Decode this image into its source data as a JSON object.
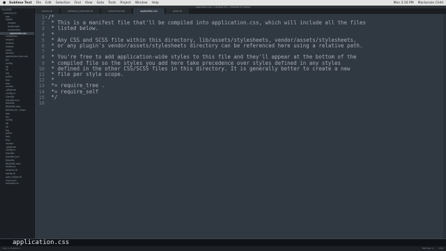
{
  "menubar": {
    "items": [
      "Sublime Text",
      "File",
      "Edit",
      "Selection",
      "Find",
      "View",
      "Goto",
      "Tools",
      "Project",
      "Window",
      "Help"
    ],
    "right_items": [
      "Mon 3:16 PM",
      "Mackenzie Child"
    ]
  },
  "window": {
    "title": "application.css — cardinal_fm — [Trashed for Share]"
  },
  "sidebar": {
    "items": [
      "FOLDERS",
      "cardinal_fm",
      "app",
      "assets",
      "images",
      "javascripts",
      "stylesheets",
      "application.css",
      "controllers",
      "helpers",
      "mailers",
      "models",
      "views",
      "layouts",
      "application.html.erb",
      "bin",
      "config",
      "db",
      "lib",
      "log",
      "public",
      "test",
      "tmp",
      "vendor",
      ".gitignore",
      "config.ru",
      "Gemfile",
      "Gemfile.lock",
      "Rakefile",
      "README.rdoc",
      "Refresh fm - finals",
      "app",
      "bin",
      "config",
      "db",
      "lib",
      "log",
      "public",
      "test",
      "tmp",
      "vendor",
      ".gitignore",
      "config.ru",
      "Gemfile",
      "Gemfile.lock",
      "Rakefile",
      "README.rdoc",
      "routes.rb",
      "schema.rb",
      "seeds.rb",
      "spec_helper.rb",
      "users.yml",
      "welcome.rb"
    ],
    "selected_index": 7
  },
  "tabs": [
    {
      "label": "routes.rb",
      "active": false
    },
    {
      "label": "welcome_controller.rb",
      "active": false
    },
    {
      "label": "index.html.erb",
      "active": false
    },
    {
      "label": "application.css",
      "active": true
    },
    {
      "label": "route.rb",
      "active": false
    }
  ],
  "editor": {
    "line_numbers": [
      "1",
      "2",
      "3",
      "4",
      "5",
      "6",
      "7",
      "8",
      "9",
      "10",
      "11",
      "12",
      "13",
      "14",
      "15",
      "16"
    ],
    "lines": [
      "/*",
      " * This is a manifest file that'll be compiled into application.css, which will include all the files",
      " * listed below.",
      " *",
      " * Any CSS and SCSS file within this directory, lib/assets/stylesheets, vendor/assets/stylesheets,",
      " * or any plugin's vendor/assets/stylesheets directory can be referenced here using a relative path.",
      " *",
      " * You're free to add application-wide styles to this file and they'll appear at the bottom of the",
      " * compiled file so the styles you add here take precedence over styles defined in any styles",
      " * defined in the other CSS/SCSS files in this directory. It is generally better to create a new",
      " * file per style scope.",
      " *",
      " *= require_tree .",
      " *= require_self",
      " */",
      ""
    ]
  },
  "findbar": {
    "value": "application.css"
  },
  "statusbar": {
    "left": "Line 1, Column 1",
    "right_items": [
      "Tab Size: 2",
      "CSS"
    ]
  }
}
